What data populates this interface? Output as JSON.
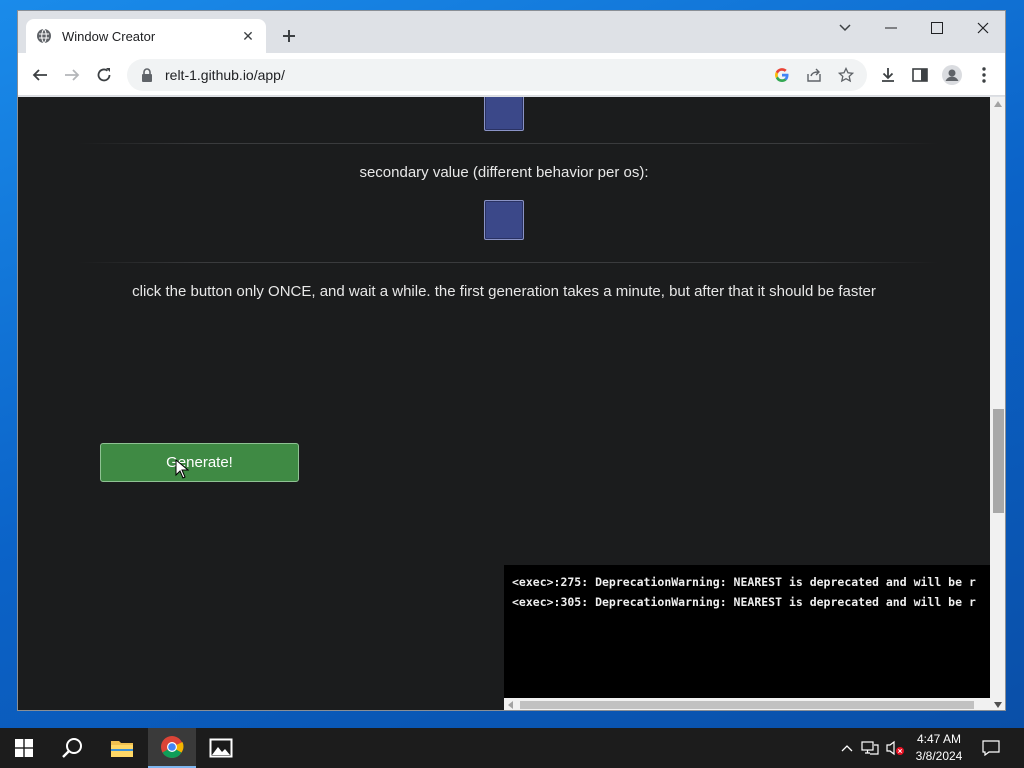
{
  "browser": {
    "tab_title": "Window Creator",
    "url": "relt-1.github.io/app/"
  },
  "page": {
    "secondary_label": "secondary value (different behavior per os):",
    "instructions": "click the button only ONCE, and wait a while. the first generation takes a minute, but after that it should be faster",
    "generate_button": "Generate!",
    "swatch_color": "#3b4889",
    "console_lines": [
      "<exec>:275: DeprecationWarning: NEAREST is deprecated and will be r",
      "<exec>:305: DeprecationWarning: NEAREST is deprecated and will be r"
    ]
  },
  "taskbar": {
    "time": "4:47 AM",
    "date": "3/8/2024"
  },
  "colors": {
    "page_bg": "#1b1c1d",
    "button_green": "#3f8a44",
    "console_bg": "#000000"
  }
}
